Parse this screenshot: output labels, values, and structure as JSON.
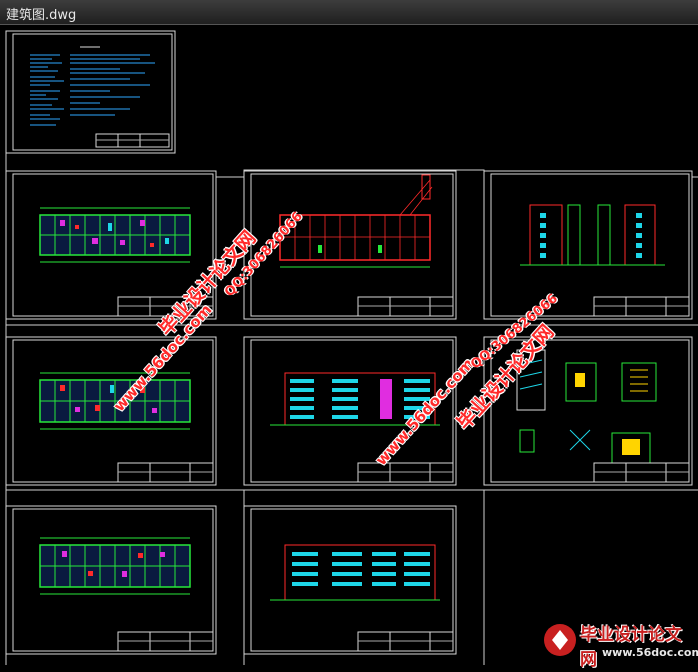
{
  "window": {
    "title": "建筑图.dwg"
  },
  "watermarks": {
    "site_cn": "毕业设计论文网",
    "url": "www.56doc.com",
    "qq": "QQ:306826066"
  },
  "logo": {
    "name": "毕业设计论文网",
    "url": "www.56doc.com"
  },
  "colors": {
    "background": "#000000",
    "frame": "#d8d8d8",
    "green": "#27e83a",
    "cyan": "#1ed6e8",
    "magenta": "#e02de0",
    "red": "#ff2a2a",
    "blue": "#3a5bff"
  }
}
